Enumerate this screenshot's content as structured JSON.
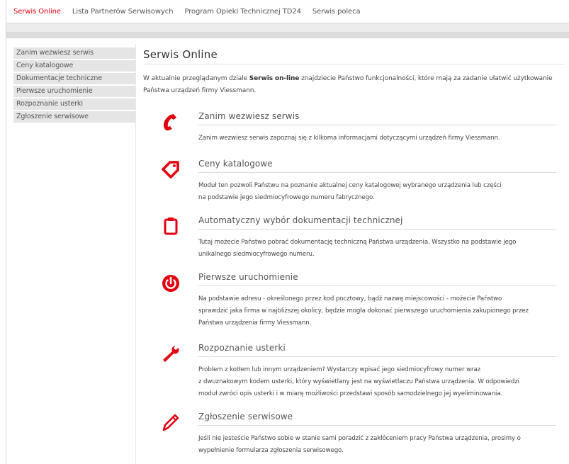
{
  "topnav": {
    "items": [
      {
        "label": "Serwis Online",
        "active": true
      },
      {
        "label": "Lista Partnerów Serwisowych",
        "active": false
      },
      {
        "label": "Program Opieki Technicznej TD24",
        "active": false
      },
      {
        "label": "Serwis poleca",
        "active": false
      }
    ]
  },
  "sidebar": {
    "items": [
      {
        "label": "Zanim wezwiesz serwis"
      },
      {
        "label": "Ceny katalogowe"
      },
      {
        "label": "Dokumentacje techniczne"
      },
      {
        "label": "Pierwsze uruchomienie"
      },
      {
        "label": "Rozpoznanie usterki"
      },
      {
        "label": "Zgłoszenie serwisowe"
      }
    ]
  },
  "main": {
    "title": "Serwis Online",
    "intro_before": "W aktualnie przeglądanym dziale ",
    "intro_bold": "Serwis on-line",
    "intro_after": " znajdziecie Państwo funkcjonalności, które mają za zadanie ułatwić użytkowanie",
    "intro_line2": "Państwa urządzeń firmy Viessmann.",
    "sections": [
      {
        "title": "Zanim wezwiesz serwis",
        "icon": "phone-icon",
        "lines": [
          "Zanim wezwiesz serwis zapoznaj się z kilkoma informacjami dotyczącymi urządzeń firmy Viessmann."
        ]
      },
      {
        "title": "Ceny katalogowe",
        "icon": "price-tag-icon",
        "lines": [
          "Moduł ten pozwoli Państwu na poznanie aktualnej ceny katalogowej wybranego urządzenia lub części",
          "na podstawie jego siedmiocyfrowego numeru fabrycznego."
        ]
      },
      {
        "title": "Automatyczny wybór dokumentacji technicznej",
        "icon": "clipboard-icon",
        "lines": [
          "Tutaj możecie Państwo pobrać dokumentację techniczną Państwa urządzenia. Wszystko na podstawie jego",
          "unikalnego siedmiocyfrowego numeru."
        ]
      },
      {
        "title": "Pierwsze uruchomienie",
        "icon": "power-icon",
        "lines": [
          "Na podstawie adresu - określonego przez kod pocztowy, bądź nazwę miejscowości - możecie Państwo",
          "sprawdzić jaka firma w najbliższej okolicy, będzie mogła dokonać pierwszego uruchomienia zakupionego przez",
          "Państwa urządzenia firmy Viessmann."
        ]
      },
      {
        "title": "Rozpoznanie usterki",
        "icon": "wrench-icon",
        "lines": [
          "Problem z kotłem lub innym urządzeniem? Wystarczy wpisać jego siedmiocyfrowy numer wraz",
          "z dwuznakowym kodem usterki, który wyświetlany jest na wyświetlaczu Państwa urządzenia. W odpowiedzi",
          "moduł zwróci opis usterki i w miarę możliwości przedstawi sposób samodzielnego jej wyeliminowania."
        ]
      },
      {
        "title": "Zgłoszenie serwisowe",
        "icon": "pencil-icon",
        "lines": [
          "Jeśli nie jesteście Państwo sobie w stanie sami poradzić z zakłóceniem pracy Państwa urządzenia, prosimy o",
          "wypełnienie formularza zgłoszenia serwisowego."
        ]
      }
    ]
  },
  "colors": {
    "accent": "#e3000f",
    "sidebar_bg": "#e5e5e5",
    "text": "#444444"
  }
}
